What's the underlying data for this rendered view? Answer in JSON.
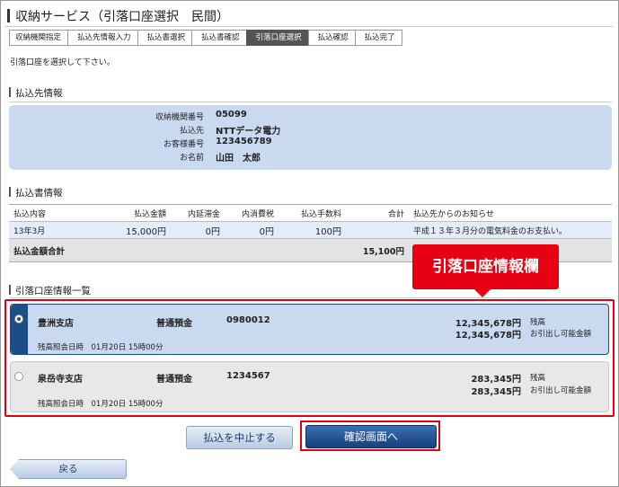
{
  "page": {
    "title": "収納サービス（引落口座選択　民間）"
  },
  "steps": [
    "収納機関指定",
    "払込先情報入力",
    "払込書選択",
    "払込書確認",
    "引落口座選択",
    "払込確認",
    "払込完了"
  ],
  "instruction": "引落口座を選択して下さい。",
  "payee": {
    "section_title": "払込先情報",
    "fields": [
      {
        "label": "収納機関番号",
        "value": "05099"
      },
      {
        "label": "払込先",
        "value": "NTTデータ電力"
      },
      {
        "label": "お客様番号",
        "value": "123456789"
      },
      {
        "label": "お名前",
        "value": "山田　太郎"
      }
    ]
  },
  "bill": {
    "section_title": "払込書情報",
    "headers": [
      "払込内容",
      "払込金額",
      "内延滞金",
      "内消費税",
      "払込手数料",
      "合計",
      "払込先からのお知らせ"
    ],
    "rows": [
      [
        "13年3月",
        "15,000円",
        "0円",
        "0円",
        "100円",
        "",
        "平成１３年３月分の電気料金のお支払い。"
      ]
    ],
    "total_label": "払込金額合計",
    "total_value": "15,100円"
  },
  "accounts": {
    "section_title": "引落口座情報一覧",
    "callout": "引落口座情報欄",
    "items": [
      {
        "selected": true,
        "branch": "豊洲支店",
        "type": "普通預金",
        "number": "0980012",
        "balance": "12,345,678円",
        "balance_label": "残高",
        "available": "12,345,678円",
        "available_label": "お引出し可能金額",
        "inquiry": "残高照会日時　01月20日 15時00分"
      },
      {
        "selected": false,
        "branch": "泉岳寺支店",
        "type": "普通預金",
        "number": "1234567",
        "balance": "283,345円",
        "balance_label": "残高",
        "available": "283,345円",
        "available_label": "お引出し可能金額",
        "inquiry": "残高照会日時　01月20日 15時00分"
      }
    ]
  },
  "buttons": {
    "cancel": "払込を中止する",
    "confirm": "確認画面へ",
    "back": "戻る"
  },
  "colors": {
    "accent": "#1e4c86",
    "highlight": "#e00012",
    "panel": "#c9daf0"
  }
}
